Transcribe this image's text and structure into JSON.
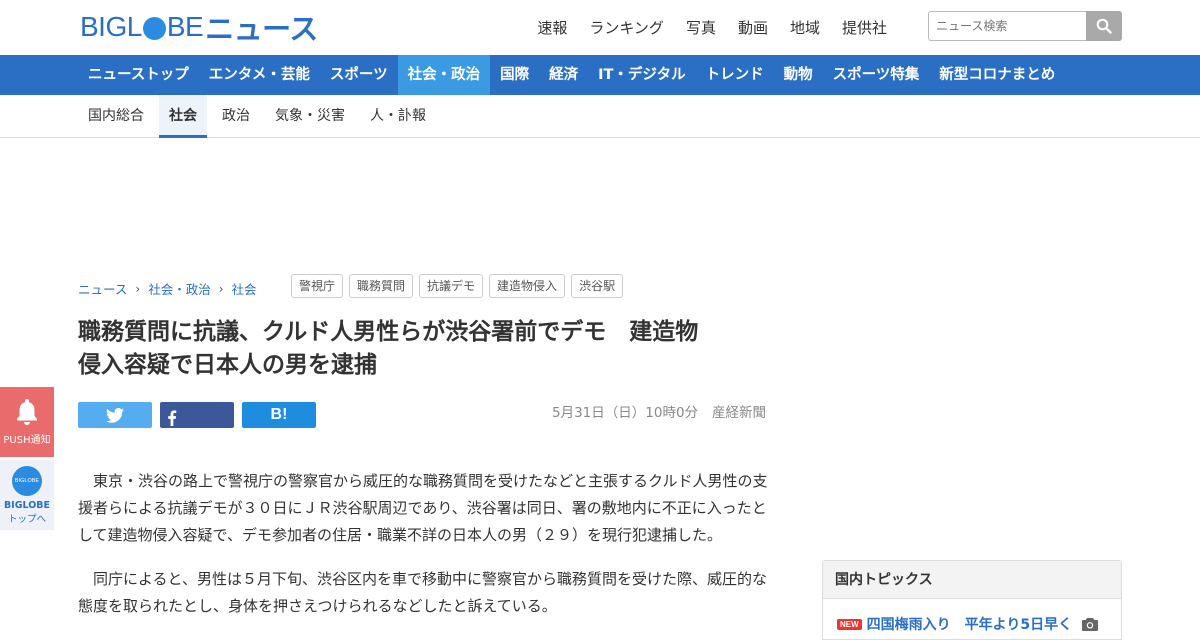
{
  "header": {
    "logo_prefix": "BIGL",
    "logo_suffix": "BE",
    "logo_news": "ニュース",
    "top_links": [
      "速報",
      "ランキング",
      "写真",
      "動画",
      "地域",
      "提供社"
    ],
    "search_placeholder": "ニュース検索"
  },
  "main_nav": {
    "items": [
      "ニューストップ",
      "エンタメ・芸能",
      "スポーツ",
      "社会・政治",
      "国際",
      "経済",
      "IT・デジタル",
      "トレンド",
      "動物",
      "スポーツ特集",
      "新型コロナまとめ"
    ],
    "active_index": 3
  },
  "sub_nav": {
    "items": [
      "国内総合",
      "社会",
      "政治",
      "気象・災害",
      "人・訃報"
    ],
    "active_index": 1
  },
  "breadcrumb": [
    "ニュース",
    "社会・政治",
    "社会"
  ],
  "tags": [
    "警視庁",
    "職務質問",
    "抗議デモ",
    "建造物侵入",
    "渋谷駅"
  ],
  "article": {
    "title_line1": "職務質問に抗議、クルド人男性らが渋谷署前でデモ　建造物",
    "title_line2": "侵入容疑で日本人の男を逮捕",
    "date": "5月31日（日）10時0分",
    "source": "産経新聞",
    "paragraphs": [
      "東京・渋谷の路上で警視庁の警察官から威圧的な職務質問を受けたなどと主張するクルド人男性の支援者らによる抗議デモが３０日にＪＲ渋谷駅周辺であり、渋谷署は同日、署の敷地内に不正に入ったとして建造物侵入容疑で、デモ参加者の住居・職業不詳の日本人の男（２９）を現行犯逮捕した。",
      "同庁によると、男性は５月下旬、渋谷区内を車で移動中に警察官から職務質問を受けた際、威圧的な態度を取られたとし、身体を押さえつけられるなどしたと訴えている。"
    ]
  },
  "share": {
    "hatena_label": "B!"
  },
  "side": {
    "push_label": "PUSH通知",
    "bg_circle": "BIGLOBE",
    "bg_line1": "BIGLOBE",
    "bg_line2": "トップへ"
  },
  "topics": {
    "header": "国内トピックス",
    "new_badge": "NEW",
    "first_item": "四国梅雨入り　平年より5日早く"
  },
  "colors": {
    "brand_blue": "#2a6fc4",
    "nav_active": "#3a9ae2",
    "twitter": "#55acee",
    "facebook": "#3b5998",
    "push": "#e96b6b"
  }
}
